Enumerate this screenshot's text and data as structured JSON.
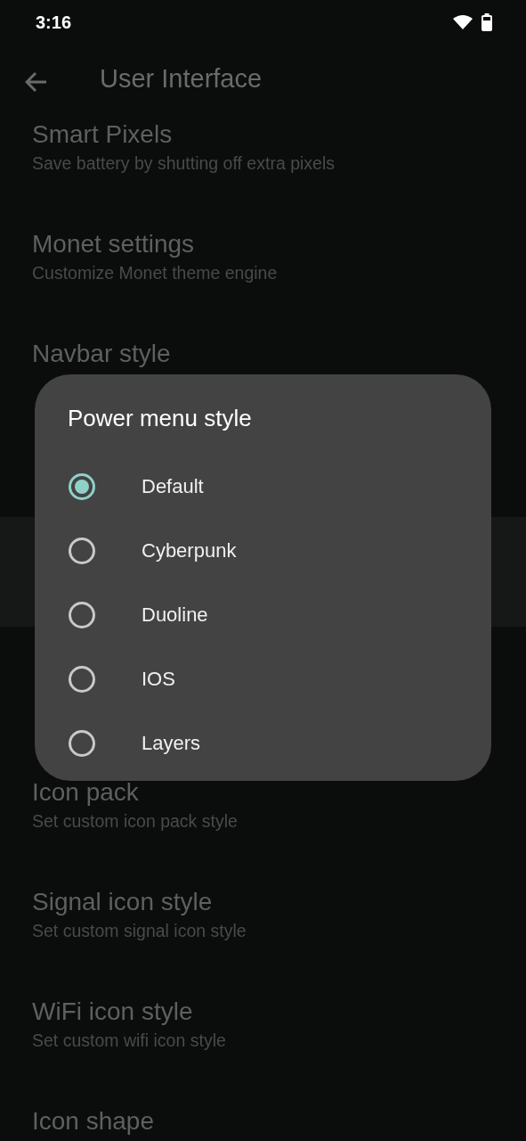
{
  "status_bar": {
    "time": "3:16"
  },
  "toolbar": {
    "title": "User Interface"
  },
  "settings_top": [
    {
      "title": "Smart Pixels",
      "summary": "Save battery by shutting off extra pixels"
    },
    {
      "title": "Monet settings",
      "summary": "Customize Monet theme engine"
    },
    {
      "title": "Navbar style"
    }
  ],
  "settings_bottom": [
    {
      "title": "Icon pack",
      "summary": "Set custom icon pack style"
    },
    {
      "title": "Signal icon style",
      "summary": "Set custom signal icon style"
    },
    {
      "title": "WiFi icon style",
      "summary": "Set custom wifi icon style"
    },
    {
      "title": "Icon shape"
    }
  ],
  "dialog": {
    "title": "Power menu style",
    "options": [
      {
        "label": "Default",
        "selected": true
      },
      {
        "label": "Cyberpunk",
        "selected": false
      },
      {
        "label": "Duoline",
        "selected": false
      },
      {
        "label": "IOS",
        "selected": false
      },
      {
        "label": "Layers",
        "selected": false
      }
    ]
  }
}
